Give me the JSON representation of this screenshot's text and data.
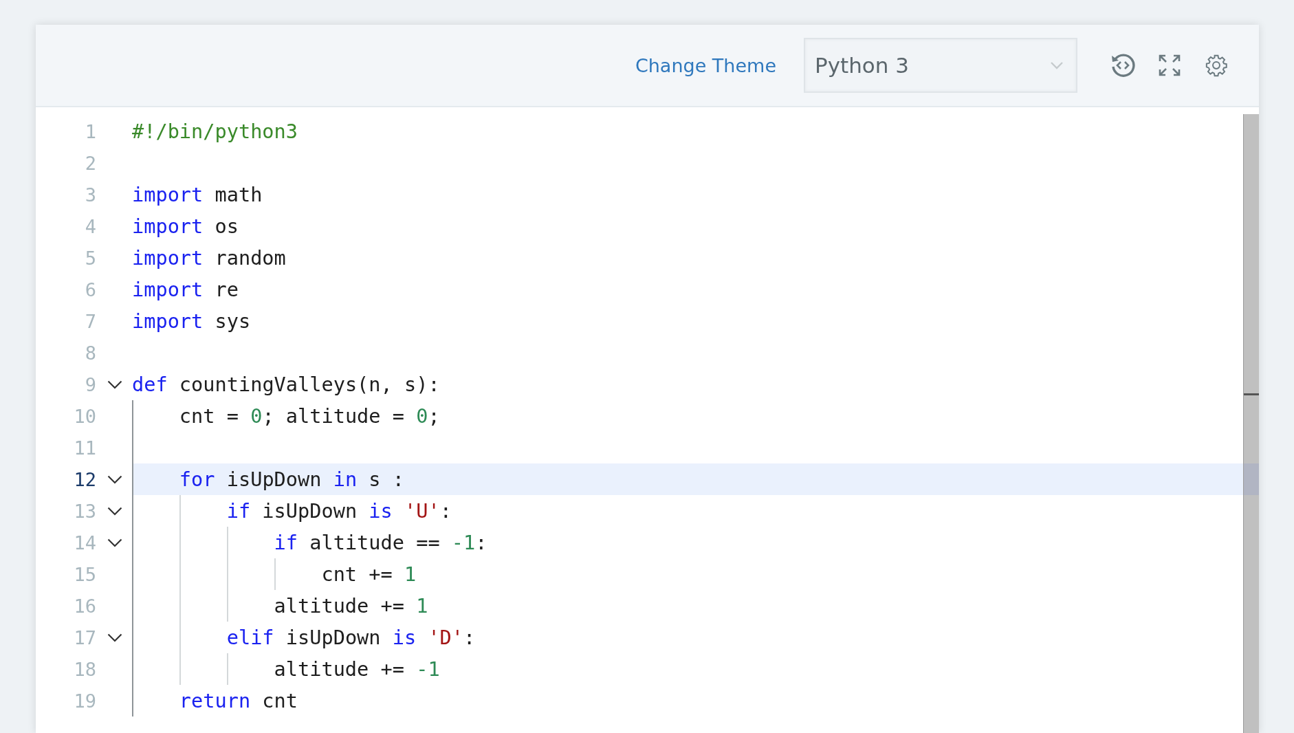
{
  "toolbar": {
    "theme_link": "Change Theme",
    "language": {
      "value": "Python 3"
    }
  },
  "editor": {
    "lines": [
      {
        "number": "1",
        "fold": false,
        "selected": false,
        "code": [
          {
            "kind": "comment",
            "t": "#!/bin/python3"
          }
        ]
      },
      {
        "number": "2",
        "fold": false,
        "selected": false
      },
      {
        "number": "3",
        "fold": false,
        "selected": false,
        "code": [
          {
            "kind": "kw",
            "t": "import"
          },
          {
            "kind": "plain",
            "t": " math"
          }
        ]
      },
      {
        "number": "4",
        "fold": false,
        "selected": false,
        "code": [
          {
            "kind": "kw",
            "t": "import"
          },
          {
            "kind": "plain",
            "t": " os"
          }
        ]
      },
      {
        "number": "5",
        "fold": false,
        "selected": false,
        "code": [
          {
            "kind": "kw",
            "t": "import"
          },
          {
            "kind": "plain",
            "t": " random"
          }
        ]
      },
      {
        "number": "6",
        "fold": false,
        "selected": false,
        "code": [
          {
            "kind": "kw",
            "t": "import"
          },
          {
            "kind": "plain",
            "t": " re"
          }
        ]
      },
      {
        "number": "7",
        "fold": false,
        "selected": false,
        "code": [
          {
            "kind": "kw",
            "t": "import"
          },
          {
            "kind": "plain",
            "t": " sys"
          }
        ]
      },
      {
        "number": "8",
        "fold": false,
        "selected": false
      },
      {
        "number": "9",
        "fold": true,
        "selected": false,
        "code": [
          {
            "kind": "kw",
            "t": "def"
          },
          {
            "kind": "plain",
            "t": " countingValleys(n, s):"
          }
        ]
      },
      {
        "number": "10",
        "fold": false,
        "selected": false,
        "code": [
          {
            "kind": "plain",
            "t": "    cnt = "
          },
          {
            "kind": "num",
            "t": "0"
          },
          {
            "kind": "plain",
            "t": "; altitude = "
          },
          {
            "kind": "num",
            "t": "0"
          },
          {
            "kind": "plain",
            "t": ";"
          }
        ]
      },
      {
        "number": "11",
        "fold": false,
        "selected": false
      },
      {
        "number": "12",
        "fold": true,
        "selected": true,
        "code": [
          {
            "kind": "kw",
            "t": "    for"
          },
          {
            "kind": "plain",
            "t": " isUpDown "
          },
          {
            "kind": "kw",
            "t": "in"
          },
          {
            "kind": "plain",
            "t": " s :"
          }
        ]
      },
      {
        "number": "13",
        "fold": true,
        "selected": false,
        "code": [
          {
            "kind": "kw",
            "t": "        if"
          },
          {
            "kind": "plain",
            "t": " isUpDown "
          },
          {
            "kind": "kw",
            "t": "is"
          },
          {
            "kind": "str",
            "t": " 'U'"
          },
          {
            "kind": "plain",
            "t": ":"
          }
        ]
      },
      {
        "number": "14",
        "fold": true,
        "selected": false,
        "code": [
          {
            "kind": "kw",
            "t": "            if"
          },
          {
            "kind": "plain",
            "t": " altitude == "
          },
          {
            "kind": "num",
            "t": "-1"
          },
          {
            "kind": "plain",
            "t": ":"
          }
        ]
      },
      {
        "number": "15",
        "fold": false,
        "selected": false,
        "code": [
          {
            "kind": "plain",
            "t": "                cnt += "
          },
          {
            "kind": "num",
            "t": "1"
          }
        ]
      },
      {
        "number": "16",
        "fold": false,
        "selected": false,
        "code": [
          {
            "kind": "plain",
            "t": "            altitude += "
          },
          {
            "kind": "num",
            "t": "1"
          }
        ]
      },
      {
        "number": "17",
        "fold": true,
        "selected": false,
        "code": [
          {
            "kind": "kw",
            "t": "        elif"
          },
          {
            "kind": "plain",
            "t": " isUpDown "
          },
          {
            "kind": "kw",
            "t": "is"
          },
          {
            "kind": "str",
            "t": " 'D'"
          },
          {
            "kind": "plain",
            "t": ":"
          }
        ]
      },
      {
        "number": "18",
        "fold": false,
        "selected": false,
        "code": [
          {
            "kind": "plain",
            "t": "            altitude += "
          },
          {
            "kind": "num",
            "t": "-1"
          }
        ]
      },
      {
        "number": "19",
        "fold": false,
        "selected": false,
        "code": [
          {
            "kind": "kw",
            "t": "    return"
          },
          {
            "kind": "plain",
            "t": " cnt"
          }
        ]
      }
    ]
  }
}
